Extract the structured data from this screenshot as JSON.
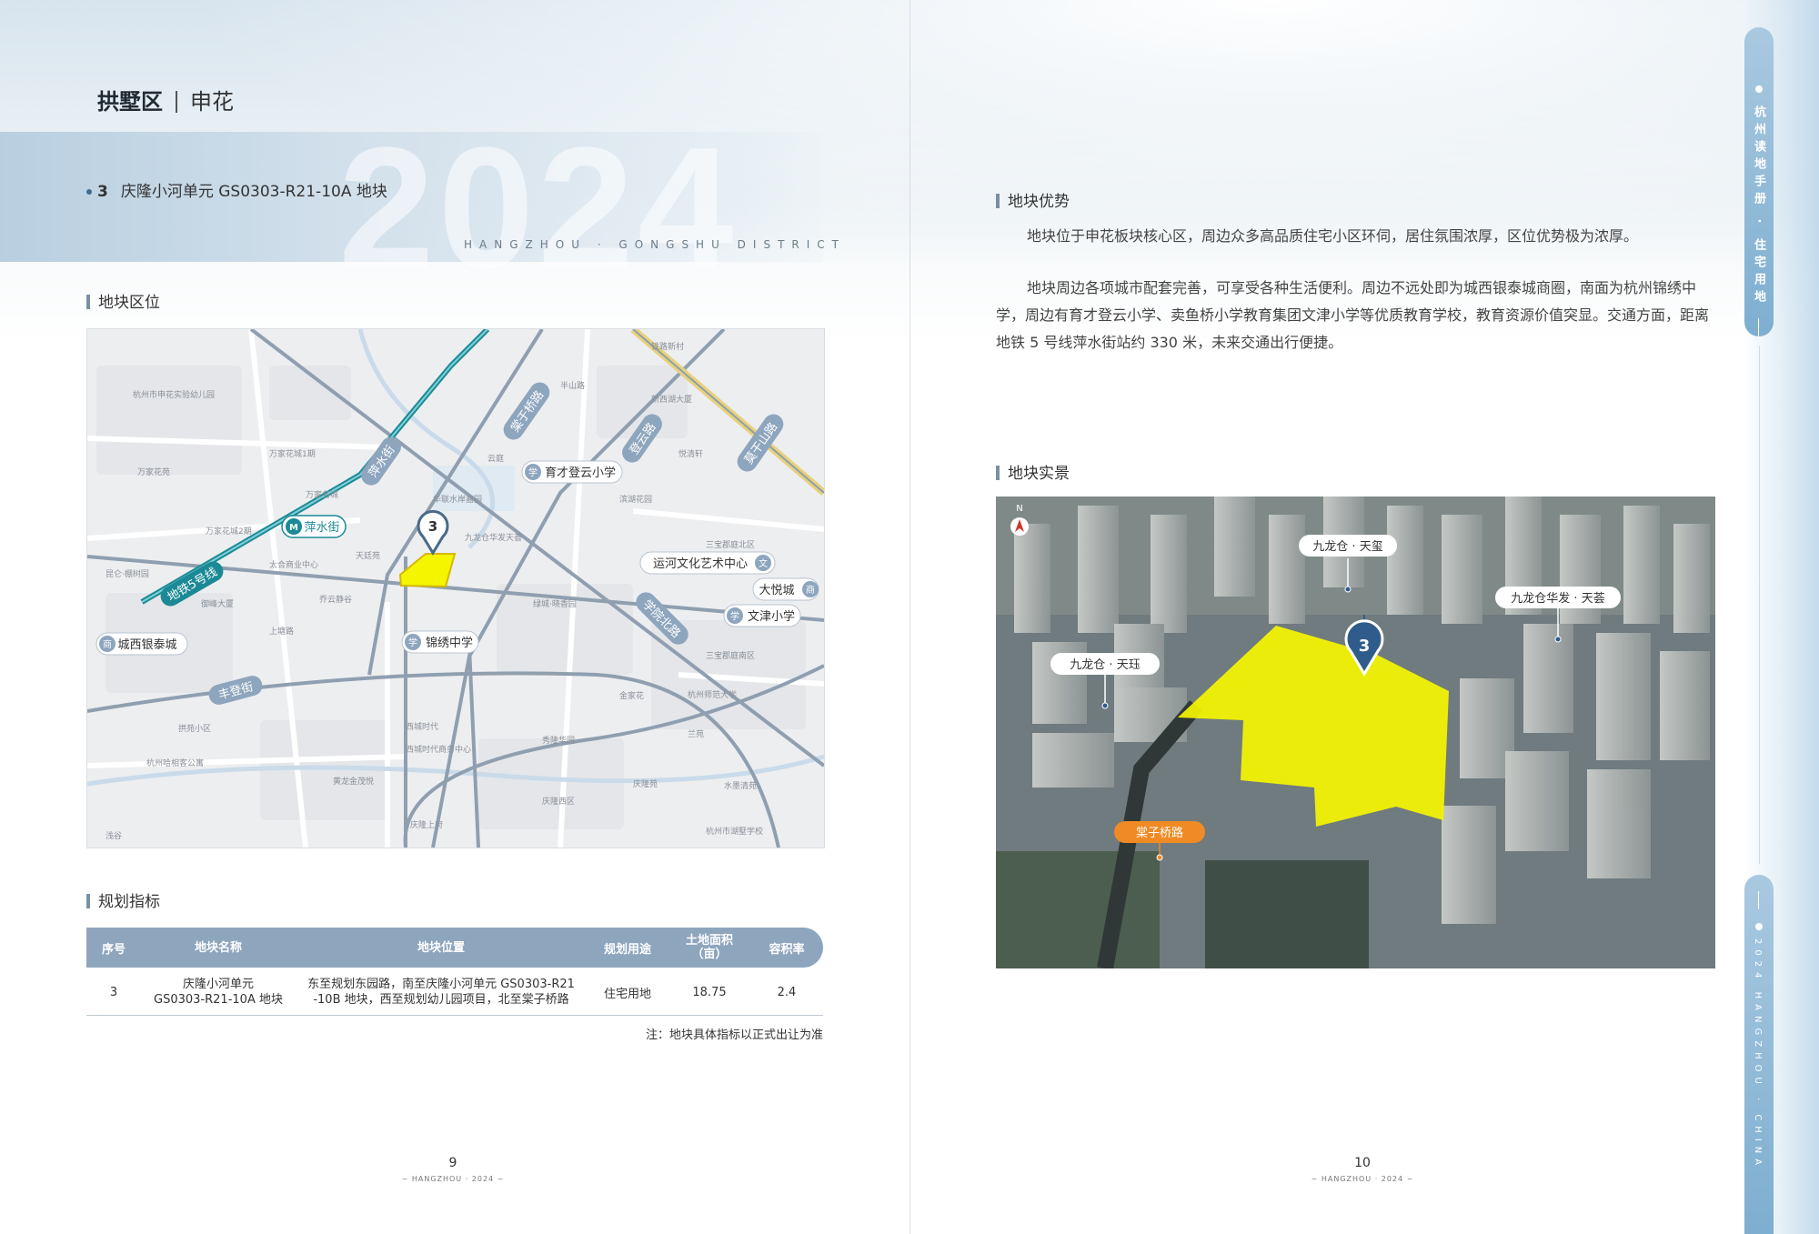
{
  "header": {
    "district": "拱墅区",
    "area": "申花"
  },
  "hero": {
    "watermark": "2024",
    "district_en": "HANGZHOU · GONGSHU DISTRICT"
  },
  "plot": {
    "number": "3",
    "name": "庆隆小河单元 GS0303-R21-10A 地块"
  },
  "sections": {
    "location": "地块区位",
    "planning": "规划指标",
    "advantage": "地块优势",
    "photo": "地块实景"
  },
  "map": {
    "marker": "3",
    "roads": [
      "萍水街",
      "地铁5号线",
      "丰登街",
      "登云路",
      "棠于桥路",
      "莫干山路",
      "学院北路"
    ],
    "pois": [
      "育才登云小学",
      "运河文化艺术中心",
      "大悦城",
      "文津小学",
      "锦绣中学",
      "城西银泰城"
    ],
    "metro": "萍水街",
    "small_labels": [
      "杭州市申花实验幼儿园",
      "万家花城1期",
      "万家花苑",
      "九龙仓华发天荟",
      "天廷苑",
      "太合商业中心",
      "乔云静谷",
      "上塘路",
      "万家花城2期",
      "御峰大厦",
      "昆仑·棚树园",
      "杭州师范大学",
      "金家花",
      "庆隆苑",
      "拱苑小区",
      "杭州哈相客公寓",
      "西城时代商务中心",
      "黄龙金茂悦",
      "庆隆上府",
      "庆隆西区",
      "秀隆华园",
      "杭州市湖墅学校",
      "三宝郡庭北区",
      "三宝郡庭南区",
      "绿城·晓香园",
      "西城时代",
      "新西湖大厦",
      "华联水岸嘉园",
      "铁路新村",
      "滨湖花园",
      "兰苑",
      "云庭",
      "悦清轩",
      "浅谷",
      "万家名城",
      "半山路",
      "水墨清苑"
    ]
  },
  "table": {
    "headers": [
      "序号",
      "地块名称",
      "地块位置",
      "规划用途",
      "土地面积\n（亩）",
      "容积率"
    ],
    "rows": [
      [
        "3",
        "庆隆小河单元\nGS0303-R21-10A 地块",
        "东至规划东园路，南至庆隆小河单元 GS0303-R21\n-10B 地块，西至规划幼儿园项目，北至棠子桥路",
        "住宅用地",
        "18.75",
        "2.4"
      ]
    ],
    "note": "注：地块具体指标以正式出让为准"
  },
  "advantage": {
    "p1": "地块位于申花板块核心区，周边众多高品质住宅小区环伺，居住氛围浓厚，区位优势极为浓厚。",
    "p2": "地块周边各项城市配套完善，可享受各种生活便利。周边不远处即为城西银泰城商圈，南面为杭州锦绣中学，周边有育才登云小学、卖鱼桥小学教育集团文津小学等优质教育学校，教育资源价值突显。交通方面，距离地铁 5 号线萍水街站约 330 米，未来交通出行便捷。"
  },
  "photo": {
    "compass": "N",
    "marker": "3",
    "labels": [
      "九龙仓 · 天玺",
      "九龙仓华发 · 天荟",
      "九龙仓 · 天珏"
    ],
    "road": "棠子桥路"
  },
  "footer": {
    "left_page": "9",
    "right_page": "10",
    "tag": "~ HANGZHOU · 2024 ~"
  },
  "side_tab": {
    "title": "杭州读地手册 · 住宅用地",
    "subtitle": "2024 HANGZHOU · CHINA"
  },
  "colors": {
    "accent": "#8ea5be",
    "plot_yellow": "#f5f500",
    "road_orange": "#f08a24",
    "marker_blue": "#2f5c8a"
  }
}
